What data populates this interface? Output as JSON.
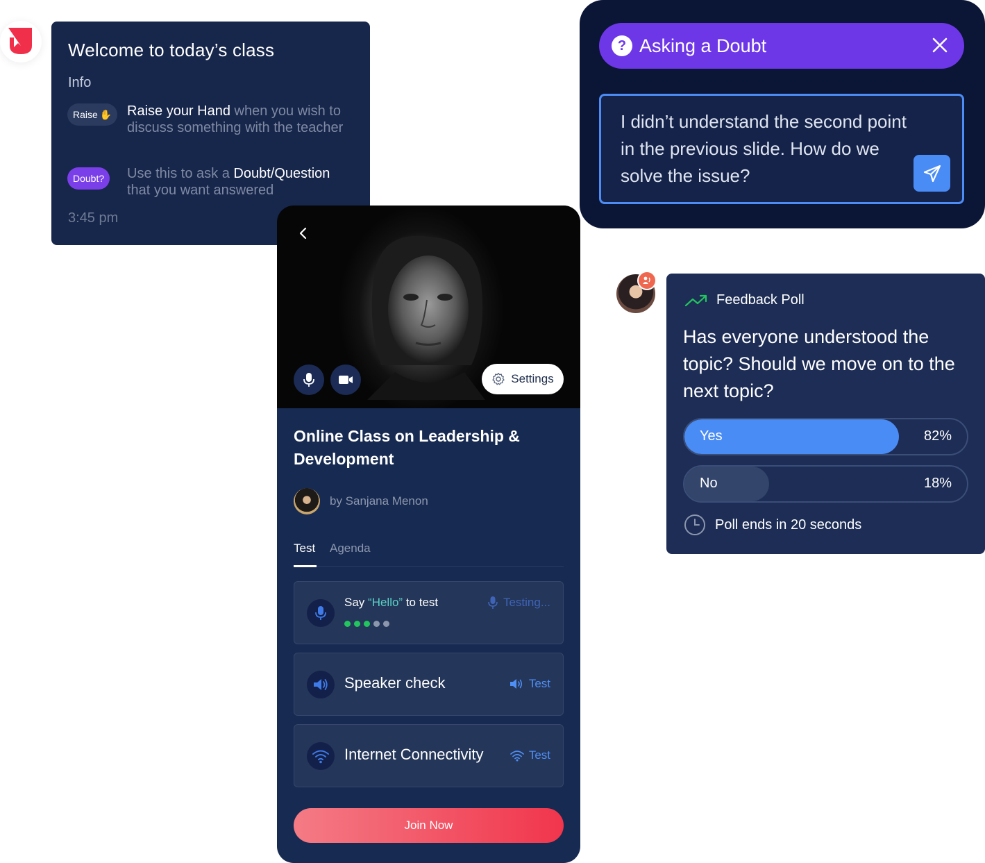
{
  "colors": {
    "navy": "#17264b",
    "purple": "#6d37e8",
    "accent_blue": "#4a8cf5",
    "join_red": "#f1354c",
    "green": "#22c55e"
  },
  "welcome": {
    "title": "Welcome to today’s class",
    "info": "Info",
    "raise_pill": "Raise",
    "raise_bold": "Raise your Hand",
    "raise_rest": " when you wish to discuss something with the teacher",
    "doubt_pill": "Doubt?",
    "doubt_pre": "Use this to ask a ",
    "doubt_bold": "Doubt/Question",
    "doubt_rest": " that you want answered",
    "time": "3:45 pm"
  },
  "doubt": {
    "title": "Asking a Doubt",
    "message": "I didn’t understand the second point in the previous slide. How do we solve the issue?",
    "icons": [
      "question-icon",
      "close-icon",
      "send-icon"
    ]
  },
  "poll": {
    "label": "Feedback Poll",
    "question": "Has everyone understood the topic? Should we move on to the next topic?",
    "options": [
      {
        "label": "Yes",
        "percent": "82%",
        "fill": 0.76
      },
      {
        "label": "No",
        "percent": "18%",
        "fill": 0.3
      }
    ],
    "footer": "Poll ends in 20 seconds"
  },
  "class": {
    "settings": "Settings",
    "title": "Online Class on Leadership & Development",
    "host": "by Sanjana Menon",
    "tabs": [
      "Test",
      "Agenda"
    ],
    "say_pre": "Say ",
    "say_hl": "“Hello”",
    "say_post": " to test",
    "testing": "Testing...",
    "mic_level": "3 of 5",
    "speaker_label": "Speaker check",
    "speaker_action": "Test",
    "internet_label": "Internet Connectivity",
    "internet_action": "Test",
    "join": "Join Now"
  }
}
